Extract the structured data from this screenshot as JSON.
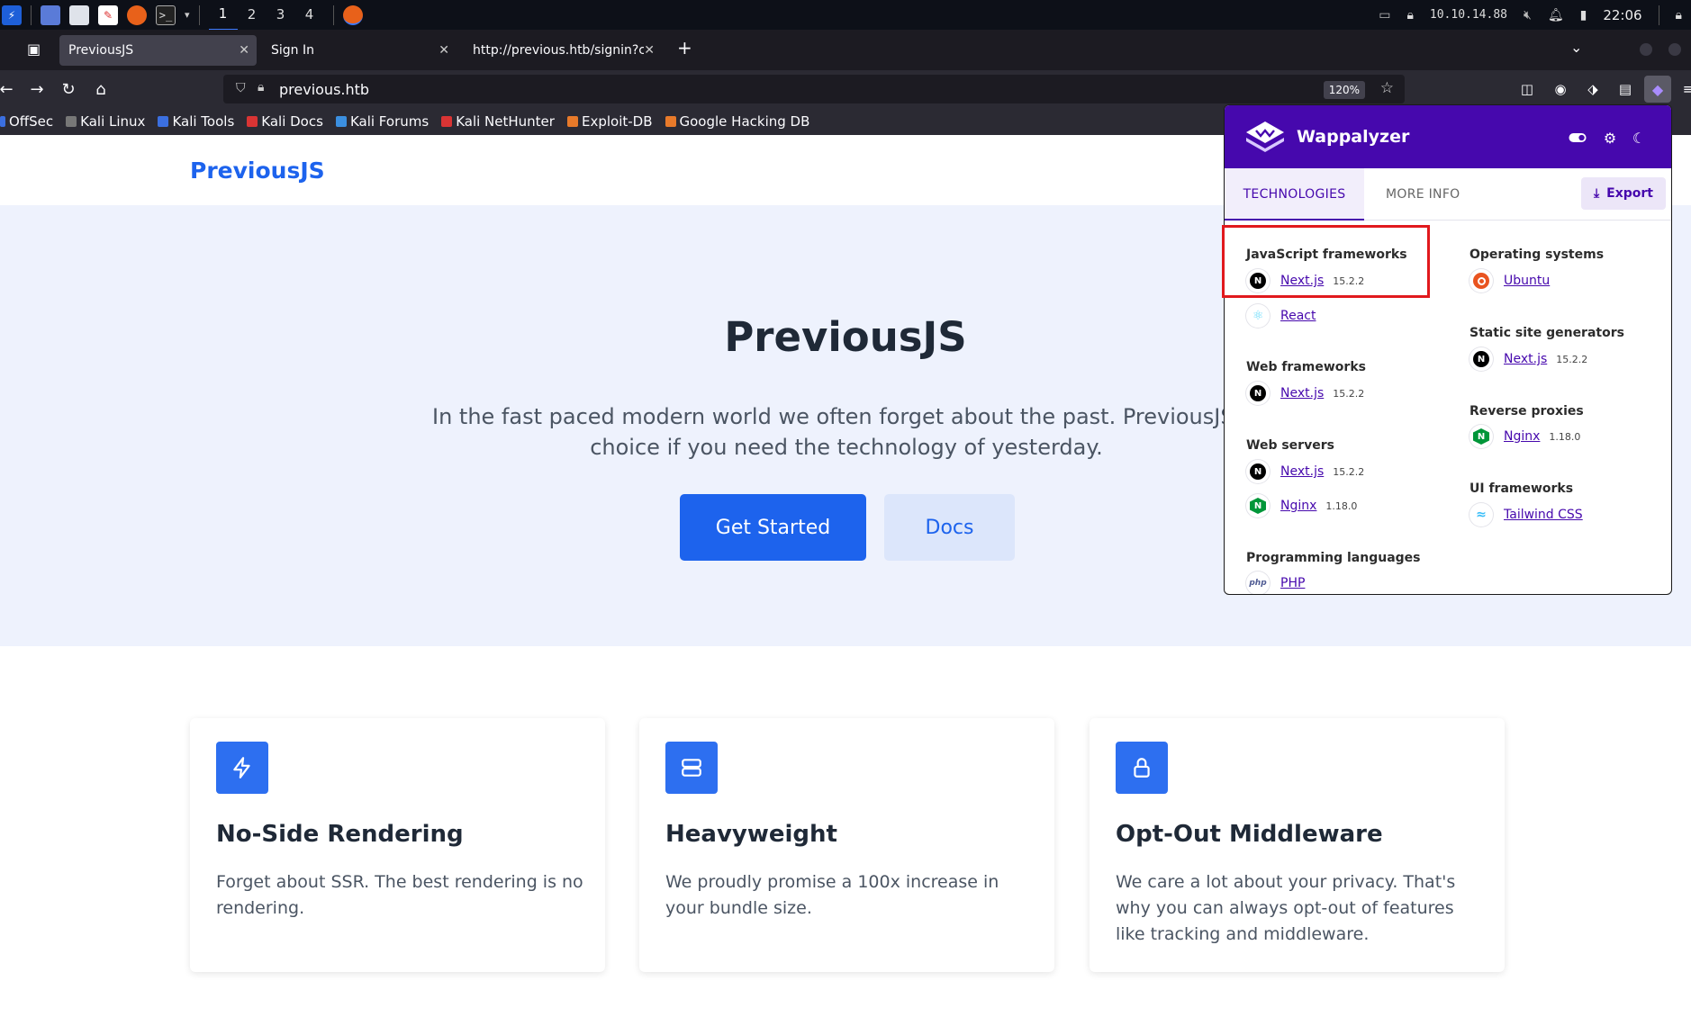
{
  "taskbar": {
    "workspaces": [
      "1",
      "2",
      "3",
      "4"
    ],
    "ip": "10.10.14.88",
    "clock": "22:06"
  },
  "tabs": [
    {
      "title": "PreviousJS"
    },
    {
      "title": "Sign In"
    },
    {
      "title": "http://previous.htb/signin?ca"
    }
  ],
  "nav": {
    "url": "previous.htb",
    "zoom": "120%"
  },
  "bookmarks": [
    "OffSec",
    "Kali Linux",
    "Kali Tools",
    "Kali Docs",
    "Kali Forums",
    "Kali NetHunter",
    "Exploit-DB",
    "Google Hacking DB"
  ],
  "site": {
    "brand": "PreviousJS",
    "hero_title": "PreviousJS",
    "hero_lead_1": "In the fast paced modern world we often forget about the past. PreviousJS is the ri",
    "hero_lead_2": "choice if you need the technology of yesterday.",
    "cta_primary": "Get Started",
    "cta_secondary": "Docs",
    "cards": [
      {
        "title": "No-Side Rendering",
        "text": "Forget about SSR. The best rendering is no rendering.",
        "icon": "lightning-icon"
      },
      {
        "title": "Heavyweight",
        "text": "We proudly promise a 100x increase in your bundle size.",
        "icon": "server-icon"
      },
      {
        "title": "Opt-Out Middleware",
        "text": "We care a lot about your privacy. That's why you can always opt-out of features like tracking and middleware.",
        "icon": "lock-icon"
      }
    ]
  },
  "wappalyzer": {
    "name": "Wappalyzer",
    "tab_technologies": "TECHNOLOGIES",
    "tab_more_info": "MORE INFO",
    "export_label": "Export",
    "left_column": [
      {
        "category": "JavaScript frameworks",
        "items": [
          {
            "name": "Next.js",
            "version": "15.2.2"
          },
          {
            "name": "React",
            "version": ""
          }
        ]
      },
      {
        "category": "Web frameworks",
        "items": [
          {
            "name": "Next.js",
            "version": "15.2.2"
          }
        ]
      },
      {
        "category": "Web servers",
        "items": [
          {
            "name": "Next.js",
            "version": "15.2.2"
          },
          {
            "name": "Nginx",
            "version": "1.18.0"
          }
        ]
      },
      {
        "category": "Programming languages",
        "items": [
          {
            "name": "PHP",
            "version": ""
          }
        ]
      }
    ],
    "right_column": [
      {
        "category": "Operating systems",
        "items": [
          {
            "name": "Ubuntu",
            "version": ""
          }
        ]
      },
      {
        "category": "Static site generators",
        "items": [
          {
            "name": "Next.js",
            "version": "15.2.2"
          }
        ]
      },
      {
        "category": "Reverse proxies",
        "items": [
          {
            "name": "Nginx",
            "version": "1.18.0"
          }
        ]
      },
      {
        "category": "UI frameworks",
        "items": [
          {
            "name": "Tailwind CSS",
            "version": ""
          }
        ]
      }
    ]
  },
  "colors": {
    "accent": "#1d63ed",
    "wappalyzer_purple": "#4608ad",
    "highlight_red": "#e1191d"
  }
}
